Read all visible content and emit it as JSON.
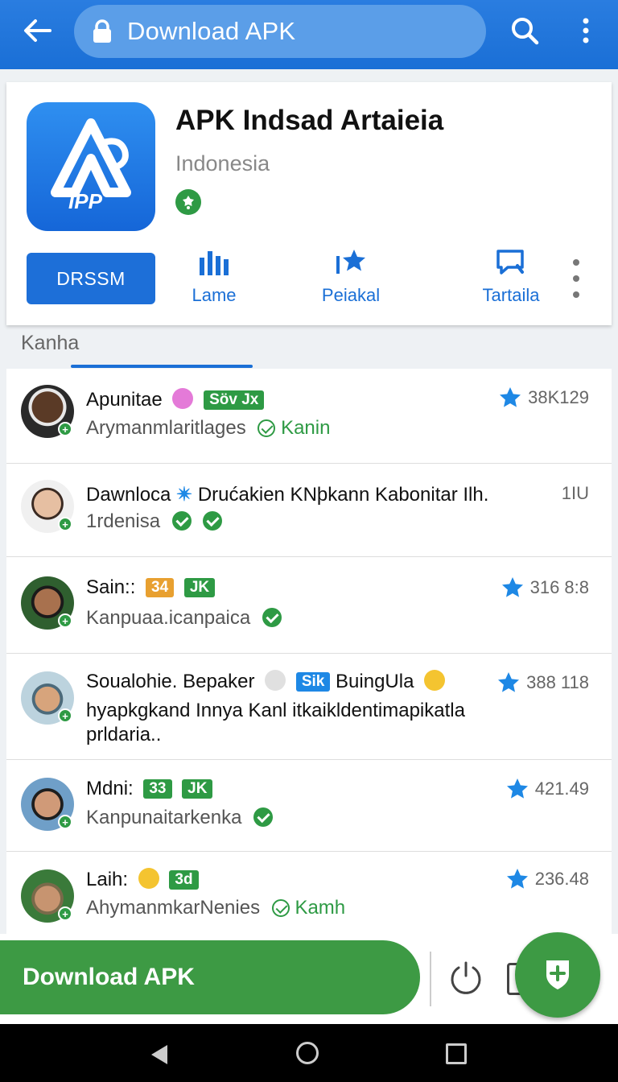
{
  "toolbar": {
    "url_text": "Download APK",
    "accent": "#1a6fd6"
  },
  "app": {
    "title": "APK Indsad Artaieia",
    "subtitle": "Indonesia",
    "icon_text": "ЇPP",
    "install_label": "DRSSM",
    "actions": [
      {
        "label": "Lame",
        "icon": "bar-chart-icon"
      },
      {
        "label": "Peiakal",
        "icon": "star-icon"
      },
      {
        "label": "Tartaila",
        "icon": "comment-icon"
      }
    ]
  },
  "section": {
    "label": "Kanha"
  },
  "rows": [
    {
      "title": "Apunitae",
      "tag": "Söv Jx",
      "subtitle": "Arymanmlaritlages",
      "verified": "Kanin",
      "stat": "38K129"
    },
    {
      "title": "Dawnloca",
      "title_rest": "Drućakien KNþkann Kabonitar Ilh.",
      "subtitle": "1rdenisa",
      "stat": "1IU"
    },
    {
      "title": "Sain::",
      "tag1": "34",
      "tag2": "JK",
      "subtitle": "Kanpuaa.icanpaica",
      "stat": "316 8:8"
    },
    {
      "title": "Soualohie. Bepaker",
      "tag": "Sik",
      "title_rest": "BuingUla",
      "line2": "hyapkgkand Innya Kanl itkaikldentimapikatla",
      "line3": "prldaria..",
      "stat": "388 118"
    },
    {
      "title": "Mdni:",
      "tag1": "33",
      "tag2": "JK",
      "subtitle": "Kanpunaitarkenka",
      "stat": "421.49"
    },
    {
      "title": "Laih:",
      "tag": "3d",
      "subtitle": "AhymanmkarNenies",
      "verified": "Kamh",
      "stat": "236.48"
    }
  ],
  "bottom": {
    "download_label": "Download APK",
    "primary_color": "#3d9a44"
  }
}
